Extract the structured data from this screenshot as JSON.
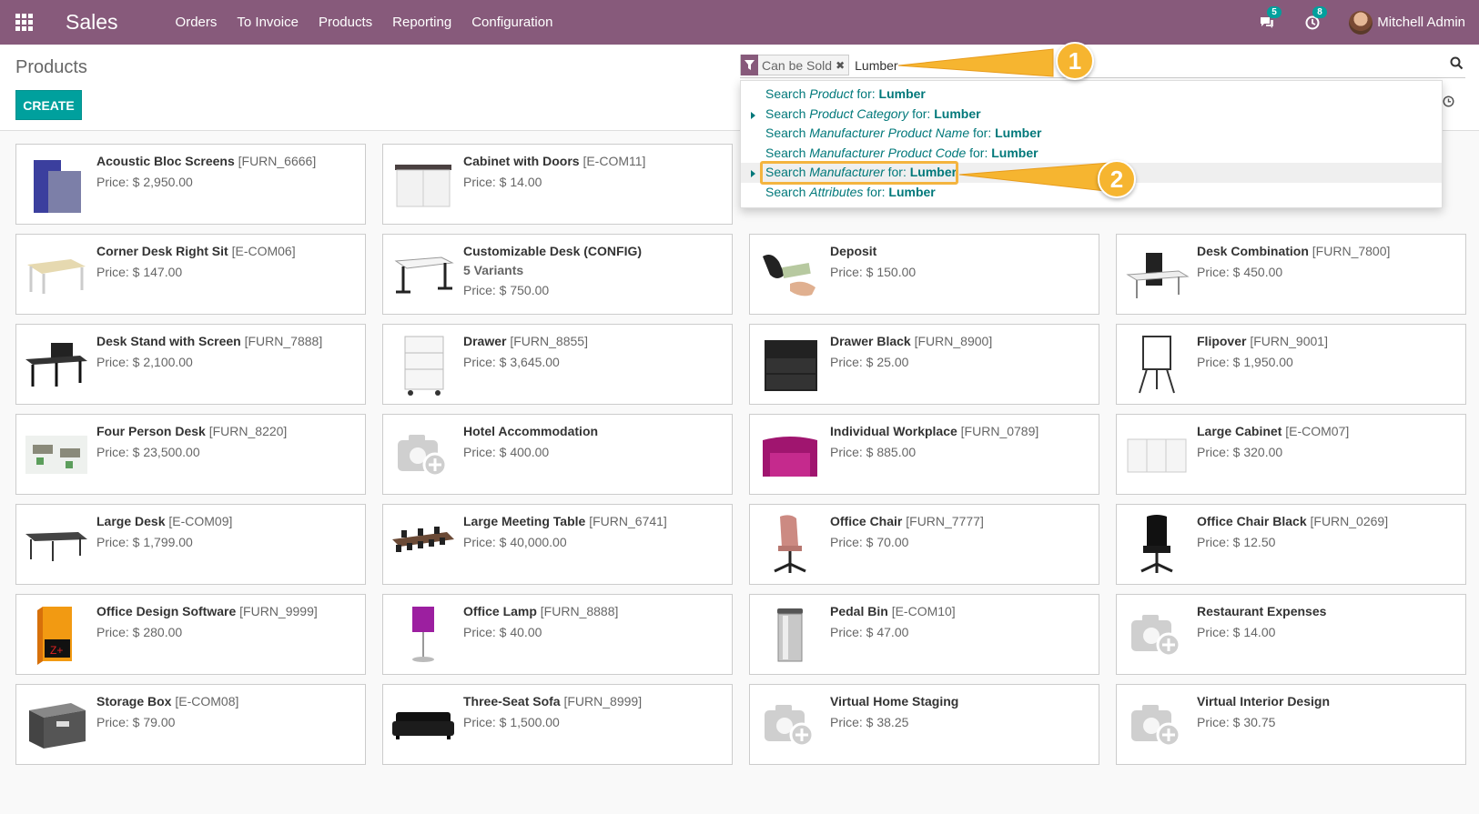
{
  "navbar": {
    "app_name": "Sales",
    "menu": [
      "Orders",
      "To Invoice",
      "Products",
      "Reporting",
      "Configuration"
    ],
    "messages_count": "5",
    "activities_count": "8",
    "user_name": "Mitchell Admin",
    "color": "#875a7b"
  },
  "control_panel": {
    "breadcrumb": "Products",
    "create_label": "CREATE",
    "facet_label": "Can be Sold",
    "search_value": "Lumber"
  },
  "dropdown": {
    "items": [
      {
        "prefix": "Search ",
        "field": "Product",
        "mid": " for: ",
        "term": "Lumber"
      },
      {
        "prefix": "Search ",
        "field": "Product Category",
        "mid": " for: ",
        "term": "Lumber"
      },
      {
        "prefix": "Search ",
        "field": "Manufacturer Product Name",
        "mid": " for: ",
        "term": "Lumber"
      },
      {
        "prefix": "Search ",
        "field": "Manufacturer Product Code",
        "mid": " for: ",
        "term": "Lumber"
      },
      {
        "prefix": "Search ",
        "field": "Manufacturer",
        "mid": " for: ",
        "term": "Lumber"
      },
      {
        "prefix": "Search ",
        "field": "Attributes",
        "mid": " for: ",
        "term": "Lumber"
      }
    ]
  },
  "callouts": [
    "1",
    "2"
  ],
  "products": [
    {
      "name": "Acoustic Bloc Screens",
      "ref": "[FURN_6666]",
      "variants": "",
      "price": "Price: $ 2,950.00",
      "icon": "screen-icon"
    },
    {
      "name": "Cabinet with Doors",
      "ref": "[E-COM11]",
      "variants": "",
      "price": "Price: $ 14.00",
      "icon": "cabinet-icon"
    },
    {
      "name": "",
      "ref": "",
      "variants": "",
      "price": "",
      "icon": "hidden"
    },
    {
      "name": "",
      "ref": "",
      "variants": "",
      "price": "",
      "icon": "hidden"
    },
    {
      "name": "Corner Desk Right Sit",
      "ref": "[E-COM06]",
      "variants": "",
      "price": "Price: $ 147.00",
      "icon": "corner-desk-icon"
    },
    {
      "name": "Customizable Desk (CONFIG)",
      "ref": "",
      "variants": "5 Variants",
      "price": "Price: $ 750.00",
      "icon": "desk-icon"
    },
    {
      "name": "Deposit",
      "ref": "",
      "variants": "",
      "price": "Price: $ 150.00",
      "icon": "money-icon"
    },
    {
      "name": "Desk Combination",
      "ref": "[FURN_7800]",
      "variants": "",
      "price": "Price: $ 450.00",
      "icon": "desk-combo-icon"
    },
    {
      "name": "Desk Stand with Screen",
      "ref": "[FURN_7888]",
      "variants": "",
      "price": "Price: $ 2,100.00",
      "icon": "desk-stand-icon"
    },
    {
      "name": "Drawer",
      "ref": "[FURN_8855]",
      "variants": "",
      "price": "Price: $ 3,645.00",
      "icon": "drawer-icon"
    },
    {
      "name": "Drawer Black",
      "ref": "[FURN_8900]",
      "variants": "",
      "price": "Price: $ 25.00",
      "icon": "drawer-black-icon"
    },
    {
      "name": "Flipover",
      "ref": "[FURN_9001]",
      "variants": "",
      "price": "Price: $ 1,950.00",
      "icon": "flipover-icon"
    },
    {
      "name": "Four Person Desk",
      "ref": "[FURN_8220]",
      "variants": "",
      "price": "Price: $ 23,500.00",
      "icon": "office-desk-icon"
    },
    {
      "name": "Hotel Accommodation",
      "ref": "",
      "variants": "",
      "price": "Price: $ 400.00",
      "icon": "placeholder-camera-icon"
    },
    {
      "name": "Individual Workplace",
      "ref": "[FURN_0789]",
      "variants": "",
      "price": "Price: $ 885.00",
      "icon": "workplace-icon"
    },
    {
      "name": "Large Cabinet",
      "ref": "[E-COM07]",
      "variants": "",
      "price": "Price: $ 320.00",
      "icon": "large-cabinet-icon"
    },
    {
      "name": "Large Desk",
      "ref": "[E-COM09]",
      "variants": "",
      "price": "Price: $ 1,799.00",
      "icon": "large-desk-icon"
    },
    {
      "name": "Large Meeting Table",
      "ref": "[FURN_6741]",
      "variants": "",
      "price": "Price: $ 40,000.00",
      "icon": "meeting-table-icon"
    },
    {
      "name": "Office Chair",
      "ref": "[FURN_7777]",
      "variants": "",
      "price": "Price: $ 70.00",
      "icon": "chair-pink-icon"
    },
    {
      "name": "Office Chair Black",
      "ref": "[FURN_0269]",
      "variants": "",
      "price": "Price: $ 12.50",
      "icon": "chair-black-icon"
    },
    {
      "name": "Office Design Software",
      "ref": "[FURN_9999]",
      "variants": "",
      "price": "Price: $ 280.00",
      "icon": "software-box-icon"
    },
    {
      "name": "Office Lamp",
      "ref": "[FURN_8888]",
      "variants": "",
      "price": "Price: $ 40.00",
      "icon": "lamp-icon"
    },
    {
      "name": "Pedal Bin",
      "ref": "[E-COM10]",
      "variants": "",
      "price": "Price: $ 47.00",
      "icon": "bin-icon"
    },
    {
      "name": "Restaurant Expenses",
      "ref": "",
      "variants": "",
      "price": "Price: $ 14.00",
      "icon": "placeholder-camera-icon"
    },
    {
      "name": "Storage Box",
      "ref": "[E-COM08]",
      "variants": "",
      "price": "Price: $ 79.00",
      "icon": "storage-box-icon"
    },
    {
      "name": "Three-Seat Sofa",
      "ref": "[FURN_8999]",
      "variants": "",
      "price": "Price: $ 1,500.00",
      "icon": "sofa-icon"
    },
    {
      "name": "Virtual Home Staging",
      "ref": "",
      "variants": "",
      "price": "Price: $ 38.25",
      "icon": "placeholder-camera-icon"
    },
    {
      "name": "Virtual Interior Design",
      "ref": "",
      "variants": "",
      "price": "Price: $ 30.75",
      "icon": "placeholder-camera-icon"
    }
  ]
}
